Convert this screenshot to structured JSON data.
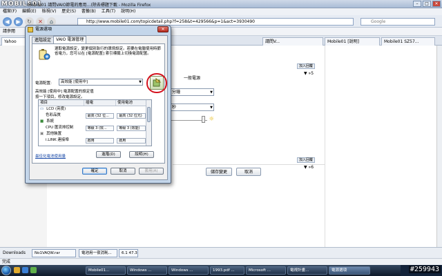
{
  "browser": {
    "logo": "MOBILE01",
    "title": "Mobile01 請問VAIO節電的應用…(除去標題下載 - Mozilla Firefox",
    "menu": [
      "檔案(F)",
      "編輯(E)",
      "檢視(V)",
      "歷史(S)",
      "書籤(B)",
      "工具(T)",
      "說明(H)"
    ],
    "url": "http://www.mobile01.com/topicdetail.php?f=258&t=429566&p=1&act=3930490",
    "search_placeholder": "Google",
    "bookmarks_label": "請參閱",
    "tabs": [
      {
        "label": "Yahoo"
      },
      {
        "label": "請問V..."
      },
      {
        "label": "Mobile01 [說明]"
      },
      {
        "label": "Mobile01 SZ57..."
      }
    ]
  },
  "page": {
    "quote_btn_1": "加入回覆",
    "page_nav_1": "▼ »5",
    "power_label": "一般電源",
    "select_1": "分鐘",
    "select_2": "秒",
    "save_btn": "儲存變更",
    "cancel_btn": "取消",
    "quote_btn_2": "加入回覆",
    "page_nav_2": "▼ »6"
  },
  "dialog": {
    "title": "電源選項",
    "close": "✕",
    "tabs": [
      "進階設定",
      "VAIO 電源管理"
    ],
    "intro": "選取電源設定，變更個別執行的環境設定。若要在電腦使用時節省電力，您可以在 [電源配置] 索引標籤上切換電源配置。",
    "plan_label": "電源配置:",
    "plan_value": "高效能 [使用中]",
    "plan_desc": "高效能 [使用中] 電源配置的設定值",
    "plan_hint": "按一下項目，修改電源設定。",
    "columns": [
      "項目",
      "插電",
      "使用電池"
    ],
    "rows": [
      {
        "item": "LCD (亮度)",
        "plugged": "",
        "battery": "",
        "group": true
      },
      {
        "item": "色彩品質",
        "plugged": "最高 (32 位...",
        "battery": "最高 (32 位元)",
        "group": false
      },
      {
        "item": "系統",
        "plugged": "",
        "battery": "",
        "group": true
      },
      {
        "item": "CPU 匯流排控制",
        "plugged": "等級 3 (效...",
        "battery": "等級 3 (效能)",
        "group": false
      },
      {
        "item": "其他裝置",
        "plugged": "",
        "battery": "",
        "group": true
      },
      {
        "item": "i.LINK 連接埠",
        "plugged": "啟用",
        "battery": "啟用",
        "group": false
      }
    ],
    "link": "最佳化電池使用量",
    "btn_advanced": "進階(D)",
    "btn_help": "說明(H)",
    "btn_ok": "確定",
    "btn_cancel": "取消",
    "btn_apply": "套用(A)"
  },
  "downloads": {
    "label": "Downloads",
    "items": [
      "No1VAQW.rar",
      "電池用一夜消耗...",
      "6.1 47.32"
    ]
  },
  "status_text": "完成",
  "taskbar": {
    "items": [
      "Mobile01...",
      "Windows ...",
      "Windows ...",
      "1993.pdf ...",
      "Microsoft ...",
      "電視計畫...",
      "電源選項"
    ]
  },
  "watermark": "#259943",
  "colors": {
    "highlight_circle": "#d4121e",
    "link": "#1a4aa8"
  }
}
